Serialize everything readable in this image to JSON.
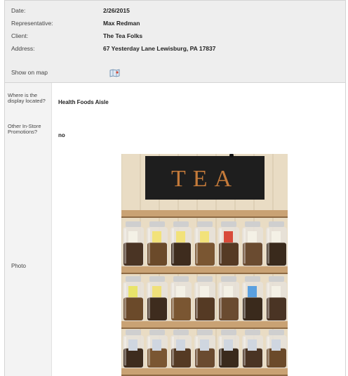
{
  "header": {
    "date_label": "Date:",
    "date_value": "2/26/2015",
    "rep_label": "Representative:",
    "rep_value": "Max Redman",
    "client_label": "Client:",
    "client_value": "The Tea Folks",
    "address_label": "Address:",
    "address_value": "67 Yesterday Lane Lewisburg, PA 17837",
    "map_label": "Show on map"
  },
  "questions": [
    {
      "label": "Where is the display located?",
      "answer": "Health Foods Aisle"
    },
    {
      "label": "Other In-Store Promotions?",
      "answer": "no"
    }
  ],
  "photo": {
    "label": "Photo",
    "sign_text": "TEA"
  },
  "icons": {
    "map": "map-icon"
  },
  "colors": {
    "header_bg": "#eeeeee",
    "label_bg": "#f3f3f3",
    "sign_bg": "#1e1e1e",
    "sign_text": "#c47a3a",
    "shelf": "#c9a274"
  }
}
